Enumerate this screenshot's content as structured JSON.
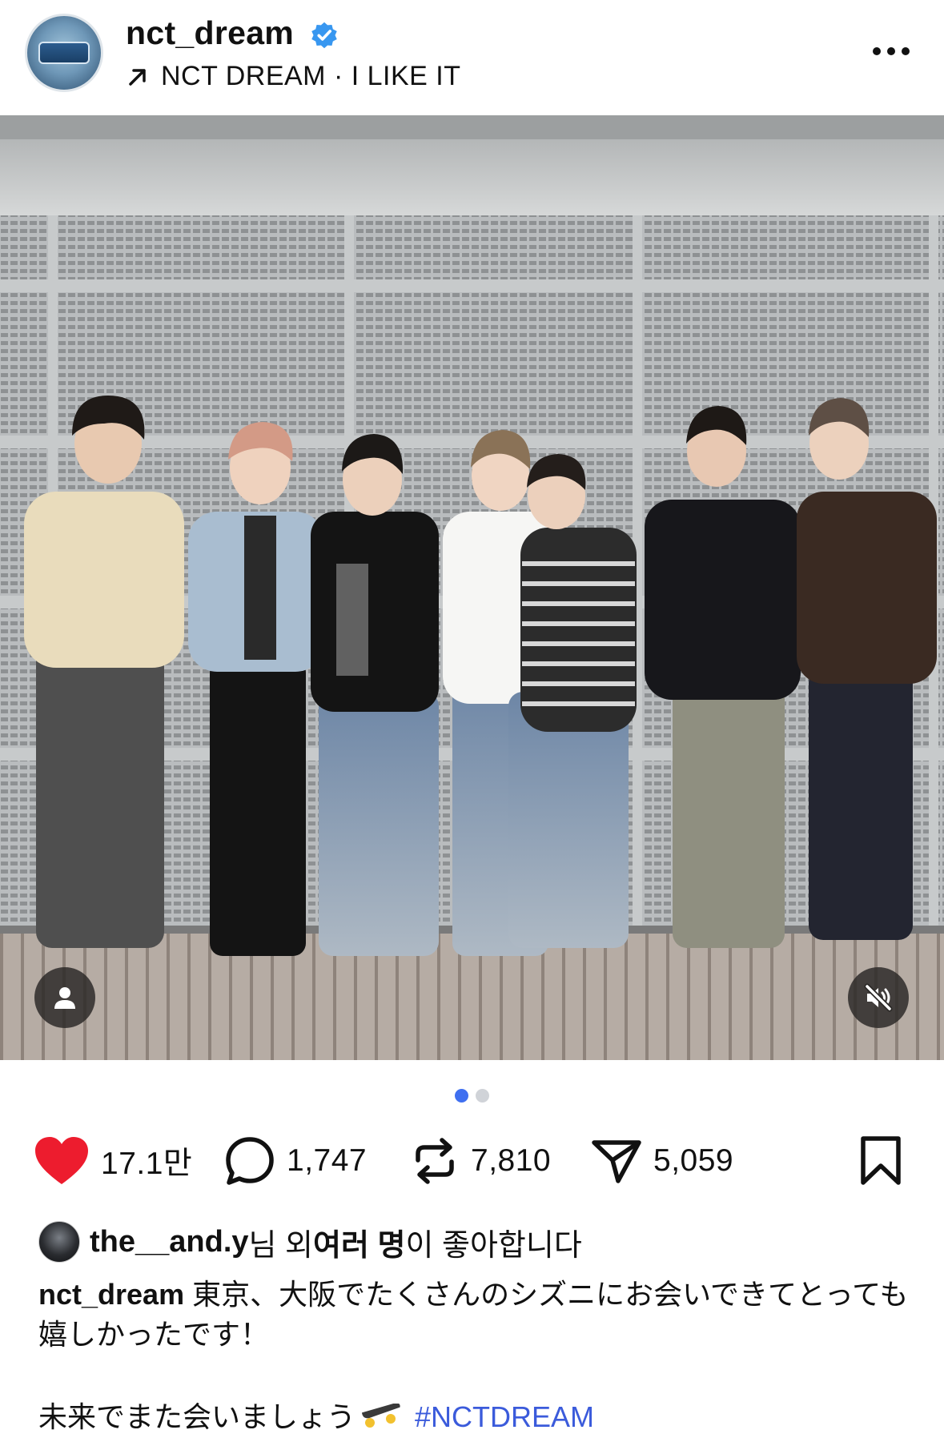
{
  "post": {
    "username": "nct_dream",
    "verified": true,
    "subtitle": "NCT DREAM · I LIKE IT",
    "arrow_icon": "arrow-up-right-icon",
    "more_icon": "more-horizontal-icon"
  },
  "media": {
    "carousel_total": 2,
    "carousel_active": 1,
    "tag_icon": "person-icon",
    "mute_icon": "speaker-muted-icon"
  },
  "actions": {
    "like_count": "17.1만",
    "comment_count": "1,747",
    "repost_count": "7,810",
    "share_count": "5,059",
    "like_color": "#ed1c2e"
  },
  "likes": {
    "liker": "the__and.y",
    "text_mid": "님 외 ",
    "others": "여러 명",
    "text_end": "이 좋아합니다"
  },
  "caption": {
    "username": "nct_dream",
    "text": "東京、大阪でたくさんのシズニにお会いできてとっても嬉しかったです！",
    "text2": "未来でまた会いましょう",
    "emoji_icon": "skateboard-icon",
    "hashtag": "#NCTDREAM",
    "hashtag_color": "#3b5bdb"
  }
}
